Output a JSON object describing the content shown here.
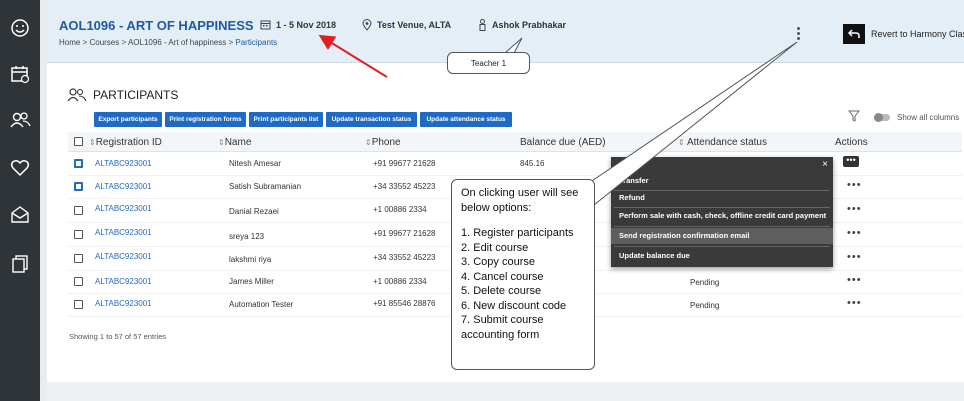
{
  "header": {
    "course_title": "AOL1096 - ART OF HAPPINESS",
    "breadcrumb": {
      "home": "Home",
      "courses": "Courses",
      "course": "AOL1096 - Art of happiness",
      "current": "Participants",
      "sep": " > "
    },
    "dates": "1 - 5 Nov 2018",
    "venue": "Test Venue, ALTA",
    "teacher": "Ashok Prabhakar",
    "revert_label": "Revert to Harmony Clas"
  },
  "section": {
    "title": "PARTICIPANTS",
    "toolbar": [
      "Export participants",
      "Print registration forms",
      "Print participants list",
      "Update transaction status",
      "Update attendance status"
    ],
    "show_all": "Show all columns"
  },
  "table": {
    "columns": [
      "Registration ID",
      "Name",
      "Phone",
      "Balance due (AED)",
      "Attendance status",
      "Actions"
    ],
    "rows": [
      {
        "id": "ALTABC923001",
        "name": "Nitesh Amesar",
        "phone": "+91 99677 21628",
        "balance": "845.16",
        "status": "",
        "checked": true
      },
      {
        "id": "ALTABC923001",
        "name": "Satish Subramanian",
        "phone": "+34 33552 45223",
        "balance": "",
        "status": "",
        "checked": true
      },
      {
        "id": "ALTABC923001",
        "name": "Danial Rezaei",
        "phone": "+1 00886 2334",
        "balance": "",
        "status": "",
        "checked": false
      },
      {
        "id": "ALTABC923001",
        "name": "sreya 123",
        "phone": "+91 99677 21628",
        "balance": "",
        "status": "",
        "checked": false
      },
      {
        "id": "ALTABC923001",
        "name": "lakshmi riya",
        "phone": "+34 33552 45223",
        "balance": "",
        "status": "",
        "checked": false
      },
      {
        "id": "ALTABC923001",
        "name": "James Miller",
        "phone": "+1 00886 2334",
        "balance": "",
        "status": "Pending",
        "checked": false
      },
      {
        "id": "ALTABC923001",
        "name": "Automation Tester",
        "phone": "+91 85546 28876",
        "balance": "",
        "status": "Pending",
        "checked": false
      }
    ],
    "entries": "Showing 1 to 57 of 57 entries"
  },
  "dropdown": {
    "close": "×",
    "items": [
      "Transfer",
      "Refund",
      "Perform sale with cash, check, offline credit card payment",
      "Send registration confirmation email",
      "Update balance due"
    ]
  },
  "annotations": {
    "teacher_bubble": "Teacher 1",
    "callout_intro": "On clicking user will see below options:",
    "callout_items": [
      "1. Register participants",
      "2. Edit course",
      "3. Copy course",
      "4. Cancel course",
      "5. Delete course",
      "6. New discount code",
      "7. Submit course accounting form"
    ],
    "arrow_color": "#e02020"
  },
  "colors": {
    "primary": "#1f6bc4",
    "sidebar": "#2f3438",
    "header_bg": "#e3eef7"
  }
}
